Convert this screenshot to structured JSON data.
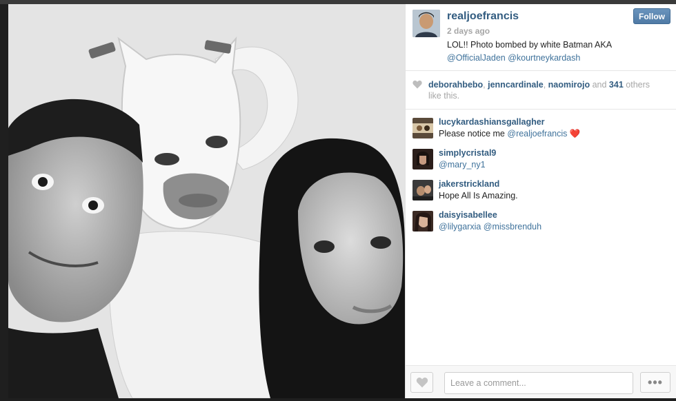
{
  "post": {
    "username": "realjoefrancis",
    "time": "2 days ago",
    "follow_label": "Follow",
    "caption_text": "LOL!! Photo bombed by white Batman AKA",
    "caption_mention_1": "@OfficialJaden",
    "caption_mention_2": "@kourtneykardash"
  },
  "likes": {
    "liker_1": "deborahbebo",
    "liker_2": "jenncardinale",
    "liker_3": "naomirojo",
    "and_text": "and",
    "count": "341",
    "others_text": "others like this."
  },
  "comments": [
    {
      "user": "lucykardashiansgallagher",
      "text": "Please notice me",
      "mention": "@realjoefrancis",
      "emoji": "❤️"
    },
    {
      "user": "simplycristal9",
      "text": "",
      "mention": "@mary_ny1",
      "emoji": ""
    },
    {
      "user": "jakerstrickland",
      "text": "Hope All Is Amazing.",
      "mention": "",
      "emoji": ""
    },
    {
      "user": "daisyisabellee",
      "text": "",
      "mention": "@lilygarxia @missbrenduh",
      "emoji": ""
    }
  ],
  "footer": {
    "comment_placeholder": "Leave a comment...",
    "more_label": "•••"
  },
  "colors": {
    "link_blue": "#325c80",
    "follow_button": "#5b86b0",
    "heart_red": "#d0021b"
  }
}
